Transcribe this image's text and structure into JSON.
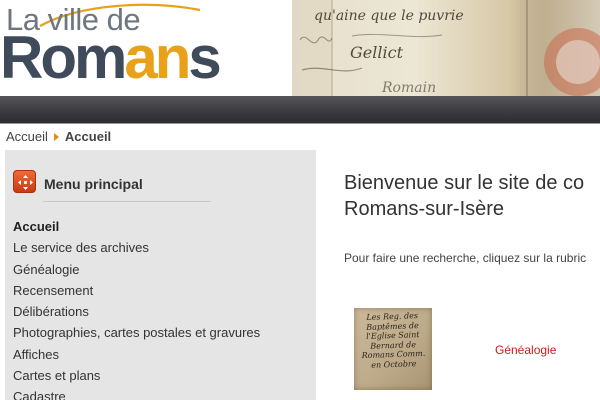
{
  "header": {
    "logo_line1": "La ville de",
    "logo_line2_part1": "Rom",
    "logo_line2_highlight": "an",
    "logo_line2_part2": "s",
    "handwriting": [
      "qu'aine que le puvrie",
      "Gellict",
      "Romain"
    ]
  },
  "breadcrumb": {
    "home": "Accueil",
    "current": "Accueil"
  },
  "sidebar": {
    "title": "Menu principal",
    "icon": "move-arrows-icon",
    "items": [
      {
        "label": "Accueil",
        "active": true
      },
      {
        "label": "Le service des archives",
        "active": false
      },
      {
        "label": "Généalogie",
        "active": false
      },
      {
        "label": "Recensement",
        "active": false
      },
      {
        "label": "Délibérations",
        "active": false
      },
      {
        "label": "Photographies, cartes postales et gravures",
        "active": false
      },
      {
        "label": "Affiches",
        "active": false
      },
      {
        "label": "Cartes et plans",
        "active": false
      },
      {
        "label": "Cadastre",
        "active": false
      }
    ]
  },
  "main": {
    "title_line1": "Bienvenue sur le site de co",
    "title_line2": "Romans-sur-Isère",
    "intro": "Pour faire une recherche, cliquez sur la rubric",
    "thumb_text": "Les Reg. des Baptêmes de l'Eglise Saint Bernard de Romans Comm. en Octobre",
    "genealogie_link": "Généalogie"
  },
  "colors": {
    "accent_orange": "#e9a11a",
    "logo_gray": "#3f4b5a",
    "link_red": "#cc1a1a",
    "sidebar_bg": "#e5e5e5",
    "nav_bar": "#3b3b40"
  }
}
